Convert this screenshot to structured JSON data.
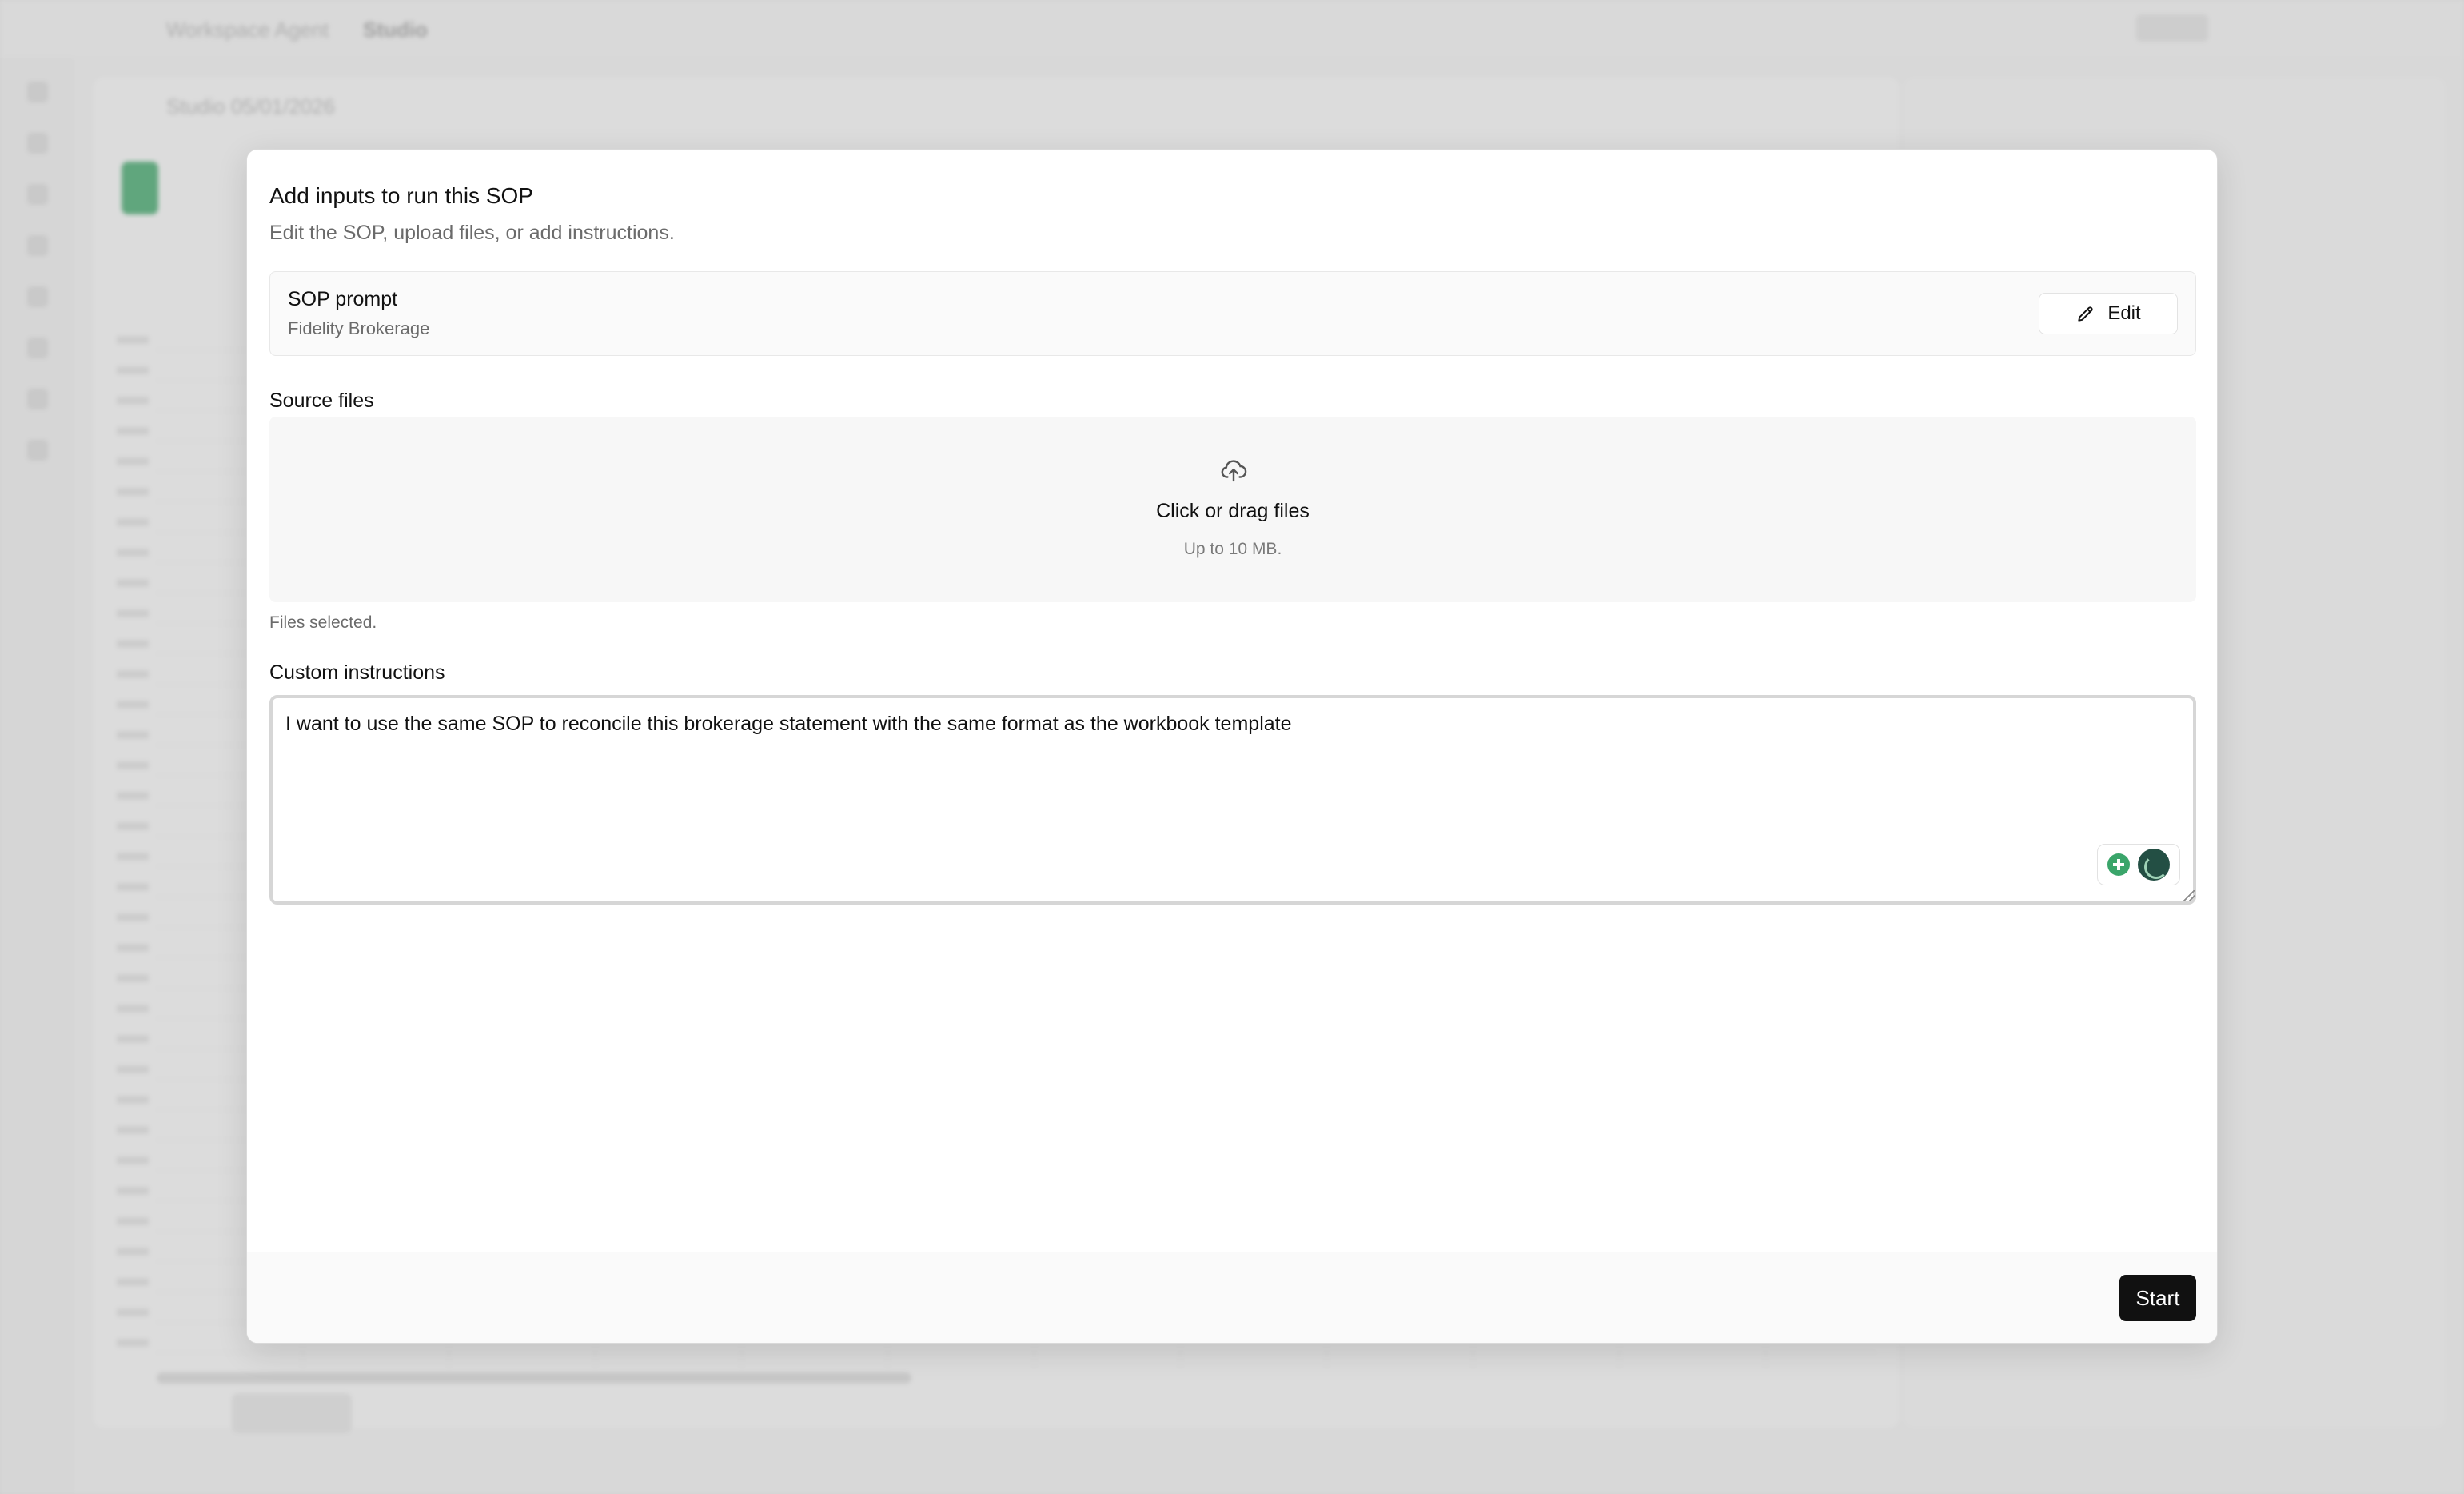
{
  "background": {
    "breadcrumb": [
      "Workspace Agent",
      "Studio"
    ],
    "document_title": "Studio 05/01/2026"
  },
  "modal": {
    "title": "Add inputs to run this SOP",
    "subtitle": "Edit the SOP, upload files, or add instructions.",
    "sop": {
      "label": "SOP prompt",
      "name": "Fidelity Brokerage",
      "edit_label": "Edit"
    },
    "source_files": {
      "label": "Source files",
      "dropzone_title": "Click or drag files",
      "dropzone_hint": "Up to 10 MB.",
      "status": "Files selected."
    },
    "custom_instructions": {
      "label": "Custom instructions",
      "value": "I want to use the same SOP to reconcile this brokerage statement with the same format as the workbook template"
    },
    "footer": {
      "start_label": "Start"
    }
  },
  "colors": {
    "primary_button": "#111111",
    "assist_green": "#3aa56a",
    "assist_avatar": "#234f44"
  },
  "icons": {
    "edit": "pencil-icon",
    "upload": "cloud-upload-icon",
    "assist": "lightbulb-plus-icon"
  }
}
